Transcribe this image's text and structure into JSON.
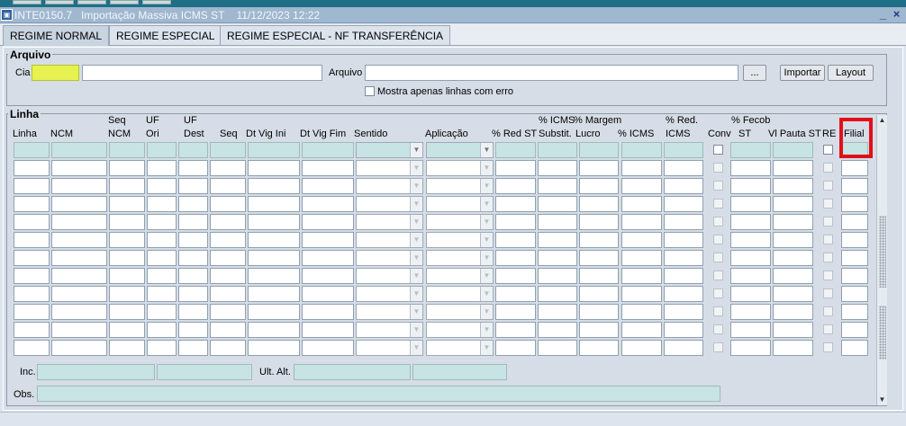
{
  "window": {
    "title": "INTE0150.7   Importação Massiva ICMS ST    11/12/2023 12:22",
    "minimize_glyph": "_",
    "close_glyph": "×"
  },
  "tabs": [
    {
      "label": "REGIME NORMAL",
      "active": true
    },
    {
      "label": "REGIME ESPECIAL",
      "active": false
    },
    {
      "label": "REGIME ESPECIAL - NF TRANSFERÊNCIA",
      "active": false
    }
  ],
  "arquivo": {
    "section_title": "Arquivo",
    "cia_label": "Cia",
    "arquivo_label": "Arquivo",
    "browse_label": "...",
    "importar_label": "Importar",
    "layout_label": "Layout",
    "only_errors_label": "Mostra apenas linhas com erro"
  },
  "linha": {
    "section_title": "Linha",
    "columns": [
      {
        "line1": "",
        "line2": "Linha"
      },
      {
        "line1": "",
        "line2": "NCM"
      },
      {
        "line1": "Seq",
        "line2": "NCM"
      },
      {
        "line1": "UF",
        "line2": "Ori"
      },
      {
        "line1": "UF",
        "line2": "Dest"
      },
      {
        "line1": "",
        "line2": "Seq"
      },
      {
        "line1": "",
        "line2": "Dt Vig Ini"
      },
      {
        "line1": "",
        "line2": "Dt Vig Fim"
      },
      {
        "line1": "",
        "line2": "Sentido"
      },
      {
        "line1": "",
        "line2": "Aplicação"
      },
      {
        "line1": "",
        "line2": "% Red ST"
      },
      {
        "line1": "% ICMS",
        "line2": "Substit."
      },
      {
        "line1": "% Margem",
        "line2": "Lucro"
      },
      {
        "line1": "",
        "line2": "% ICMS"
      },
      {
        "line1": "% Red.",
        "line2": "ICMS"
      },
      {
        "line1": "",
        "line2": "Conv"
      },
      {
        "line1": "% Fecob",
        "line2": "ST"
      },
      {
        "line1": "",
        "line2": "Vl Pauta ST"
      },
      {
        "line1": "",
        "line2": "RE"
      },
      {
        "line1": "",
        "line2": "Filial"
      }
    ],
    "row_count": 12
  },
  "audit": {
    "inc_label": "Inc.",
    "ult_alt_label": "Ult. Alt.",
    "obs_label": "Obs."
  },
  "colors": {
    "title_bar": "#9fb7cf",
    "field_teal": "#c7e3e3",
    "field_yellow": "#e5f24f",
    "highlight_red": "#e0101a"
  },
  "icons": {
    "app": "form-app-icon",
    "dropdown": "chevron-down-icon",
    "scroll_up": "arrow-up-icon",
    "scroll_down": "arrow-down-icon"
  }
}
